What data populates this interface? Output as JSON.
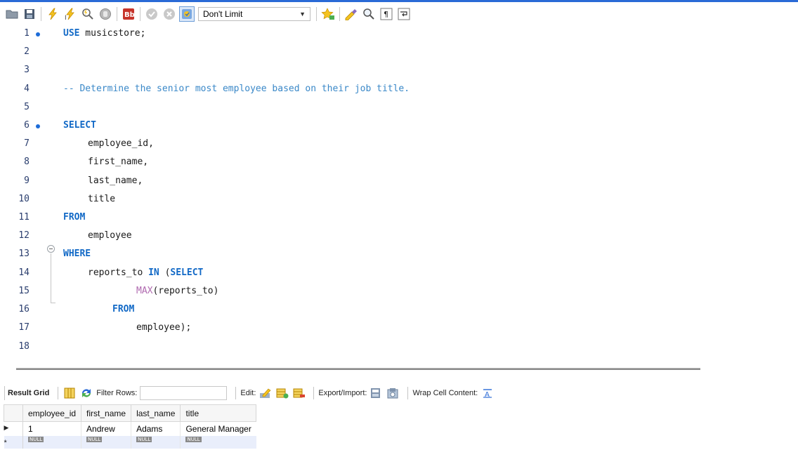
{
  "toolbar": {
    "limit_value": "Don't Limit",
    "icons": [
      "open-folder-icon",
      "save-icon",
      "execute-icon",
      "execute-current-icon",
      "explain-icon",
      "stop-icon",
      "toggle-error-icon",
      "commit-icon",
      "rollback-icon",
      "autocommit-icon",
      "limit-dropdown",
      "bookmark-star-icon",
      "beautify-icon",
      "find-icon",
      "invisible-chars-icon",
      "wrap-lines-icon"
    ]
  },
  "editor": {
    "lines": [
      {
        "n": "1",
        "text": "USE musicstore;"
      },
      {
        "n": "2",
        "text": ""
      },
      {
        "n": "3",
        "text": ""
      },
      {
        "n": "4",
        "text": "-- Determine the senior most employee based on their job title."
      },
      {
        "n": "5",
        "text": ""
      },
      {
        "n": "6",
        "text": "SELECT"
      },
      {
        "n": "7",
        "text": "employee_id,"
      },
      {
        "n": "8",
        "text": "first_name,"
      },
      {
        "n": "9",
        "text": "last_name,"
      },
      {
        "n": "10",
        "text": "title"
      },
      {
        "n": "11",
        "text": "FROM"
      },
      {
        "n": "12",
        "text": "employee"
      },
      {
        "n": "13",
        "text": "WHERE"
      },
      {
        "n": "14",
        "text": "reports_to IN (SELECT"
      },
      {
        "n": "15",
        "text": "MAX(reports_to)"
      },
      {
        "n": "16",
        "text": "FROM"
      },
      {
        "n": "17",
        "text": "employee);"
      },
      {
        "n": "18",
        "text": ""
      }
    ],
    "tokens": {
      "use_kw": "USE",
      "db": " musicstore;",
      "comment": "-- Determine the senior most employee based on their job title.",
      "select": "SELECT",
      "c1": "employee_id,",
      "c2": "first_name,",
      "c3": "last_name,",
      "c4": "title",
      "from": "FROM",
      "table": "employee",
      "where": "WHERE",
      "rt": "reports_to ",
      "in": "IN",
      "paren": " (",
      "select2": "SELECT",
      "max": "MAX",
      "maxarg": "(reports_to)",
      "from2": "FROM",
      "table2": "employee);"
    }
  },
  "result_toolbar": {
    "result_grid_label": "Result Grid",
    "filter_label": "Filter Rows:",
    "filter_value": "",
    "edit_label": "Edit:",
    "export_label": "Export/Import:",
    "wrap_label": "Wrap Cell Content:"
  },
  "grid": {
    "columns": [
      "employee_id",
      "first_name",
      "last_name",
      "title"
    ],
    "rows": [
      {
        "marker": "▶",
        "values": [
          "1",
          "Andrew",
          "Adams",
          "General Manager"
        ]
      }
    ],
    "new_row": {
      "marker": "*",
      "values": [
        "NULL",
        "NULL",
        "NULL",
        "NULL"
      ]
    }
  },
  "colors": {
    "keyword": "#1269c6",
    "comment": "#3a88c8",
    "function": "#b06ab0",
    "accent": "#2a6ad6"
  }
}
